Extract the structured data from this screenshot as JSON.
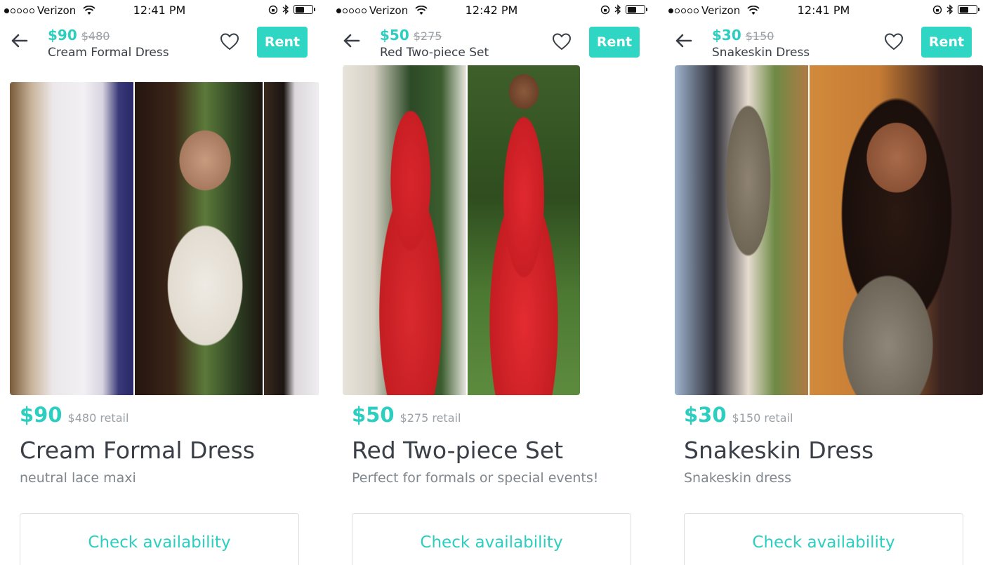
{
  "status_bars": [
    {
      "carrier": "Verizon",
      "time": "12:41 PM"
    },
    {
      "carrier": "Verizon",
      "time": "12:42 PM"
    },
    {
      "carrier": "Verizon",
      "time": "12:41 PM"
    }
  ],
  "listings": [
    {
      "header_price": "$90",
      "header_retail": "$480",
      "header_title": "Cream Formal Dress",
      "rent_label": "Rent",
      "price": "$90",
      "retail": "$480 retail",
      "title": "Cream Formal Dress",
      "description": "neutral lace maxi",
      "check_label": "Check availability"
    },
    {
      "header_price": "$50",
      "header_retail": "$275",
      "header_title": "Red Two-piece Set",
      "rent_label": "Rent",
      "price": "$50",
      "retail": "$275 retail",
      "title": "Red Two-piece Set",
      "description": "Perfect for formals or special events!",
      "check_label": "Check availability"
    },
    {
      "header_price": "$30",
      "header_retail": "$150",
      "header_title": "Snakeskin Dress",
      "rent_label": "Rent",
      "price": "$30",
      "retail": "$150 retail",
      "title": "Snakeskin Dress",
      "description": "Snakeskin dress",
      "check_label": "Check availability"
    }
  ],
  "colors": {
    "accent": "#2fd6c4",
    "price": "#2ccfbf",
    "muted": "#9aa0a6",
    "text": "#3a3f47"
  },
  "icons": [
    "back-arrow-icon",
    "heart-icon",
    "wifi-icon",
    "orientation-lock-icon",
    "bluetooth-icon",
    "battery-icon"
  ]
}
